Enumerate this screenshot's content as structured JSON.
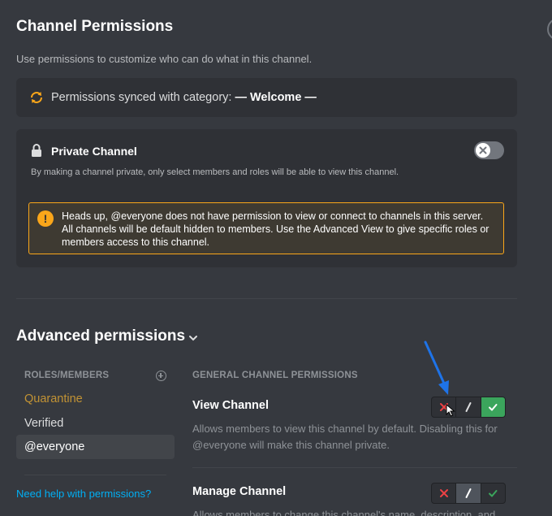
{
  "header": {
    "title": "Channel Permissions",
    "subtitle": "Use permissions to customize who can do what in this channel."
  },
  "sync": {
    "prefix": "Permissions synced with category:",
    "category": "— Welcome —",
    "icon": "sync-icon",
    "icon_color": "#faa61a"
  },
  "private_channel": {
    "title": "Private Channel",
    "description": "By making a channel private, only select members and roles will be able to view this channel.",
    "enabled": false,
    "warning": "Heads up, @everyone does not have permission to view or connect to channels in this server. All channels will be default hidden to members. Use the Advanced View to give specific roles or members access to this channel.",
    "warning_color": "#faa61a"
  },
  "advanced": {
    "title": "Advanced permissions",
    "roles_header": "ROLES/MEMBERS",
    "roles": [
      {
        "label": "Quarantine",
        "color": "#c29334",
        "selected": false
      },
      {
        "label": "Verified",
        "color": "#dcddde",
        "selected": false
      },
      {
        "label": "@everyone",
        "color": "#ffffff",
        "selected": true
      }
    ],
    "help_link": "Need help with permissions?",
    "permissions_header": "GENERAL CHANNEL PERMISSIONS",
    "permissions": [
      {
        "name": "View Channel",
        "description_line1": "Allows members to view this channel by default. Disabling this for",
        "description_line2": "@everyone will make this channel private.",
        "state": "allow"
      },
      {
        "name": "Manage Channel",
        "description_line1": "Allows members to change this channel's name, description, and text",
        "state": "neutral"
      }
    ]
  },
  "colors": {
    "background": "#36393f",
    "card": "#2f3136",
    "deny": "#ed4245",
    "allow": "#3ba55c",
    "link": "#00aff4",
    "annotation": "#1e73e8"
  }
}
